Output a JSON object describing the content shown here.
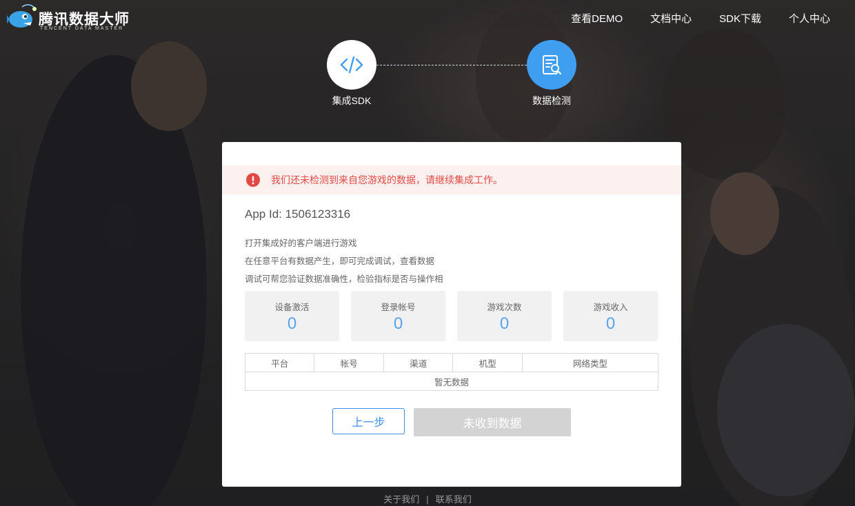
{
  "brand": {
    "name": "腾讯数据大师",
    "subtitle": "TENCENT DATA MASTER",
    "icon": "anglerfish-logo"
  },
  "nav": {
    "items": [
      "查看DEMO",
      "文档中心",
      "SDK下载",
      "个人中心"
    ]
  },
  "steps": [
    {
      "label": "集成SDK",
      "icon": "code-icon"
    },
    {
      "label": "数据检测",
      "icon": "document-search-icon"
    }
  ],
  "alert": {
    "text": "我们还未检测到来自您游戏的数据，请继续集成工作。",
    "icon": "exclamation-icon"
  },
  "app": {
    "id_text": "App Id: 1506123316"
  },
  "instructions": [
    "打开集成好的客户端进行游戏",
    "在任意平台有数据产生，即可完成调试，查看数据",
    "调试可帮您验证数据准确性，检验指标是否与操作相"
  ],
  "stats": [
    {
      "title": "设备激活",
      "value": "0"
    },
    {
      "title": "登录帐号",
      "value": "0"
    },
    {
      "title": "游戏次数",
      "value": "0"
    },
    {
      "title": "游戏收入",
      "value": "0"
    }
  ],
  "table": {
    "columns": [
      "平台",
      "帐号",
      "渠道",
      "机型",
      "网络类型"
    ],
    "empty_text": "暂无数据"
  },
  "buttons": {
    "prev": "上一步",
    "next": "未收到数据"
  },
  "footer": {
    "about": "关于我们",
    "separator": "|",
    "contact": "联系我们"
  },
  "colors": {
    "accent": "#3f9ef0",
    "alert_text": "#e14a45",
    "alert_bg": "#fdf1ef",
    "stat_value": "#58a4ee",
    "disabled_button": "#d3d3d3"
  }
}
